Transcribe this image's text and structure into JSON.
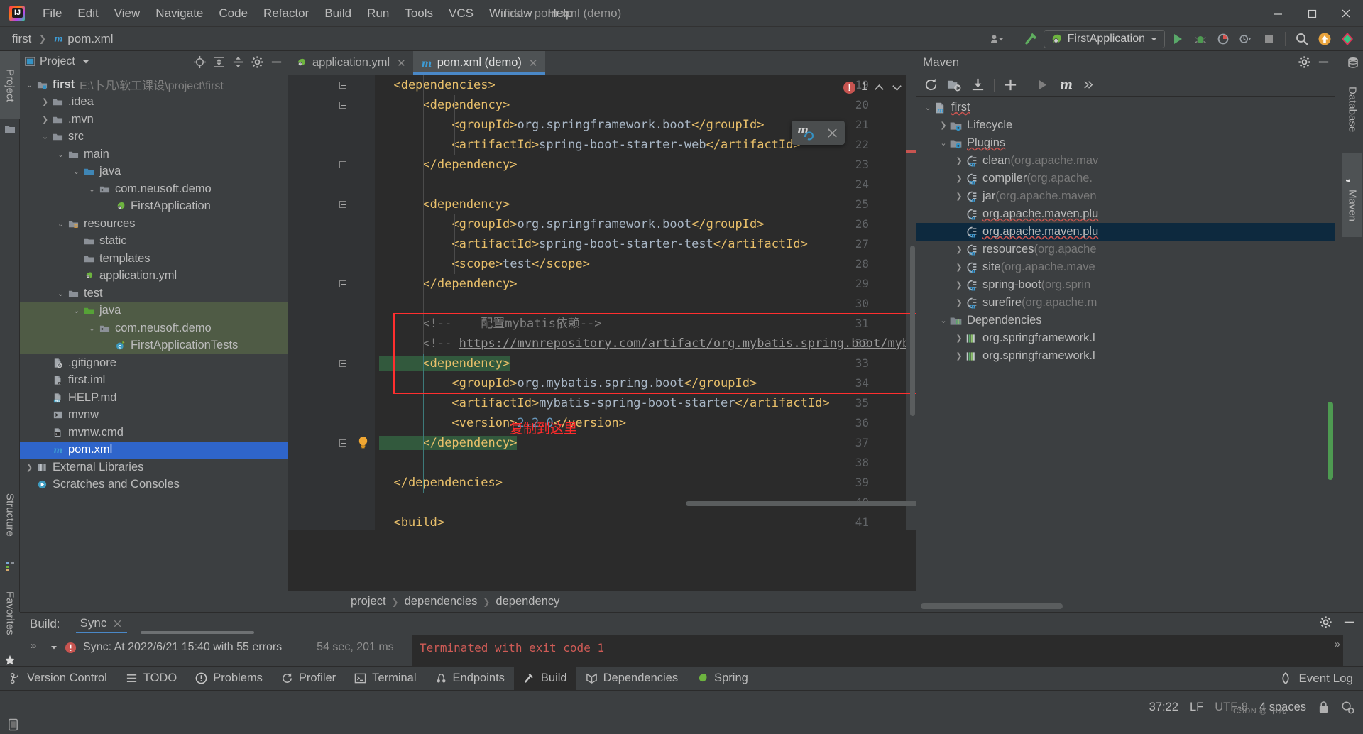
{
  "titlebar": {
    "window_title": "first - pom.xml (demo)",
    "menus": [
      "File",
      "Edit",
      "View",
      "Navigate",
      "Code",
      "Refactor",
      "Build",
      "Run",
      "Tools",
      "VCS",
      "Window",
      "Help"
    ],
    "minimize_icon": "minimize-icon",
    "maximize_icon": "maximize-icon",
    "close_icon": "close-icon"
  },
  "navbar": {
    "crumbs": [
      "first",
      "pom.xml"
    ],
    "run_config": "FirstApplication",
    "icons": [
      "user-dropdown-icon",
      "build-hammer-icon",
      "run-icon",
      "debug-icon",
      "run-coverage-icon",
      "profiler-icon",
      "stop-icon",
      "search-icon",
      "updates-icon",
      "ide-assistant-icon"
    ]
  },
  "left_stripe": {
    "project_label": "Project",
    "structure_label": "Structure",
    "favorites_label": "Favorites"
  },
  "project_panel": {
    "title": "Project",
    "actions": [
      "locate-icon",
      "expand-all-icon",
      "collapse-all-icon",
      "settings-icon",
      "hide-icon"
    ],
    "tree": [
      {
        "depth": 0,
        "arrow": "down",
        "icon": "module-folder-icon",
        "label": "first",
        "bold": true,
        "path": "E:\\卜凡\\软工课设\\project\\first"
      },
      {
        "depth": 1,
        "arrow": "right",
        "icon": "folder-icon",
        "label": ".idea"
      },
      {
        "depth": 1,
        "arrow": "right",
        "icon": "folder-icon",
        "label": ".mvn"
      },
      {
        "depth": 1,
        "arrow": "down",
        "icon": "folder-icon",
        "label": "src"
      },
      {
        "depth": 2,
        "arrow": "down",
        "icon": "folder-icon",
        "label": "main"
      },
      {
        "depth": 3,
        "arrow": "down",
        "icon": "source-folder-icon",
        "label": "java"
      },
      {
        "depth": 4,
        "arrow": "down",
        "icon": "package-icon",
        "label": "com.neusoft.demo"
      },
      {
        "depth": 5,
        "arrow": "none",
        "icon": "spring-class-icon",
        "label": "FirstApplication"
      },
      {
        "depth": 2,
        "arrow": "down",
        "icon": "resources-folder-icon",
        "label": "resources"
      },
      {
        "depth": 3,
        "arrow": "none",
        "icon": "folder-icon",
        "label": "static"
      },
      {
        "depth": 3,
        "arrow": "none",
        "icon": "folder-icon",
        "label": "templates"
      },
      {
        "depth": 3,
        "arrow": "none",
        "icon": "spring-yaml-icon",
        "label": "application.yml"
      },
      {
        "depth": 2,
        "arrow": "down",
        "icon": "folder-icon",
        "label": "test"
      },
      {
        "depth": 3,
        "arrow": "down",
        "icon": "test-folder-icon",
        "label": "java",
        "test": true
      },
      {
        "depth": 4,
        "arrow": "down",
        "icon": "package-icon",
        "label": "com.neusoft.demo",
        "test": true
      },
      {
        "depth": 5,
        "arrow": "none",
        "icon": "test-class-icon",
        "label": "FirstApplicationTests",
        "test": true
      },
      {
        "depth": 1,
        "arrow": "none",
        "icon": "gitignore-icon",
        "label": ".gitignore"
      },
      {
        "depth": 1,
        "arrow": "none",
        "icon": "iml-icon",
        "label": "first.iml"
      },
      {
        "depth": 1,
        "arrow": "none",
        "icon": "markdown-icon",
        "label": "HELP.md"
      },
      {
        "depth": 1,
        "arrow": "none",
        "icon": "shell-icon",
        "label": "mvnw"
      },
      {
        "depth": 1,
        "arrow": "none",
        "icon": "cmd-icon",
        "label": "mvnw.cmd"
      },
      {
        "depth": 1,
        "arrow": "none",
        "icon": "maven-file-icon",
        "label": "pom.xml",
        "selected": true
      },
      {
        "depth": 0,
        "arrow": "right",
        "icon": "libraries-icon",
        "label": "External Libraries"
      },
      {
        "depth": 0,
        "arrow": "none",
        "icon": "scratches-icon",
        "label": "Scratches and Consoles"
      }
    ]
  },
  "editor": {
    "tabs": [
      {
        "label": "application.yml",
        "icon": "spring-yaml-icon",
        "active": false
      },
      {
        "label": "pom.xml (demo)",
        "icon": "maven-file-icon",
        "active": true
      }
    ],
    "first_line_number": 19,
    "lines": [
      {
        "n": 19,
        "fold": "open",
        "segs": [
          {
            "t": "  <dependencies>",
            "c": "tagname"
          }
        ]
      },
      {
        "n": 20,
        "fold": "open",
        "segs": [
          {
            "t": "      <dependency>",
            "c": "tagname"
          }
        ]
      },
      {
        "n": 21,
        "fold": "none",
        "segs": [
          {
            "t": "          <groupId>",
            "c": "tagname"
          },
          {
            "t": "org.springframework.boot",
            "c": "plain"
          },
          {
            "t": "</groupId>",
            "c": "tagname"
          }
        ]
      },
      {
        "n": 22,
        "fold": "none",
        "segs": [
          {
            "t": "          <artifactId>",
            "c": "tagname"
          },
          {
            "t": "spring-boot-starter-web",
            "c": "plain"
          },
          {
            "t": "</artifactId>",
            "c": "tagname"
          }
        ]
      },
      {
        "n": 23,
        "fold": "close",
        "segs": [
          {
            "t": "      </dependency>",
            "c": "tagname"
          }
        ]
      },
      {
        "n": 24,
        "fold": "none",
        "segs": []
      },
      {
        "n": 25,
        "fold": "open",
        "segs": [
          {
            "t": "      <dependency>",
            "c": "tagname"
          }
        ]
      },
      {
        "n": 26,
        "fold": "none",
        "segs": [
          {
            "t": "          <groupId>",
            "c": "tagname"
          },
          {
            "t": "org.springframework.boot",
            "c": "plain"
          },
          {
            "t": "</groupId>",
            "c": "tagname"
          }
        ]
      },
      {
        "n": 27,
        "fold": "none",
        "segs": [
          {
            "t": "          <artifactId>",
            "c": "tagname"
          },
          {
            "t": "spring-boot-starter-test",
            "c": "plain"
          },
          {
            "t": "</artifactId>",
            "c": "tagname"
          }
        ]
      },
      {
        "n": 28,
        "fold": "none",
        "segs": [
          {
            "t": "          <scope>",
            "c": "tagname"
          },
          {
            "t": "test",
            "c": "plain"
          },
          {
            "t": "</scope>",
            "c": "tagname"
          }
        ]
      },
      {
        "n": 29,
        "fold": "close",
        "segs": [
          {
            "t": "      </dependency>",
            "c": "tagname"
          }
        ]
      },
      {
        "n": 30,
        "fold": "none",
        "segs": []
      },
      {
        "n": 31,
        "fold": "none",
        "segs": [
          {
            "t": "      <!--    配置mybatis依赖-->",
            "c": "comment"
          }
        ]
      },
      {
        "n": 32,
        "fold": "none",
        "segs": [
          {
            "t": "      <!-- ",
            "c": "comment"
          },
          {
            "t": "https://mvnrepository.com/artifact/org.mybatis.spring.boot/mybatis-sp",
            "c": "link-c"
          }
        ]
      },
      {
        "n": 33,
        "fold": "open",
        "segs": [
          {
            "t": "      <dependency>",
            "c": "tagname hl-sel"
          }
        ]
      },
      {
        "n": 34,
        "fold": "none",
        "segs": [
          {
            "t": "          <groupId>",
            "c": "tagname"
          },
          {
            "t": "org.mybatis.spring.boot",
            "c": "plain"
          },
          {
            "t": "</groupId>",
            "c": "tagname"
          }
        ]
      },
      {
        "n": 35,
        "fold": "none",
        "segs": [
          {
            "t": "          <artifactId>",
            "c": "tagname"
          },
          {
            "t": "mybatis-spring-boot-starter",
            "c": "plain"
          },
          {
            "t": "</artifactId>",
            "c": "tagname"
          }
        ]
      },
      {
        "n": 36,
        "fold": "none",
        "segs": [
          {
            "t": "          <version>",
            "c": "tagname"
          },
          {
            "t": "2.2.0",
            "c": "num"
          },
          {
            "t": "</version>",
            "c": "tagname"
          }
        ]
      },
      {
        "n": 37,
        "fold": "close",
        "segs": [
          {
            "t": "      </dependency>",
            "c": "tagname hl-sel"
          }
        ],
        "bulb": true
      },
      {
        "n": 38,
        "fold": "none",
        "segs": []
      },
      {
        "n": 39,
        "fold": "none",
        "segs": [
          {
            "t": "  </dependencies>",
            "c": "tagname"
          }
        ]
      },
      {
        "n": 40,
        "fold": "none",
        "segs": []
      },
      {
        "n": 41,
        "fold": "none",
        "segs": [
          {
            "t": "  <build>",
            "c": "tagname"
          }
        ]
      }
    ],
    "annotation_text": "复制到这里",
    "inspection": {
      "error_count": "1",
      "up_icon": "chevron-up-icon",
      "down_icon": "chevron-down-icon",
      "error_icon": "error-circle-icon"
    },
    "floating_popup": {
      "icon": "maven-reload-icon",
      "close": "close-icon"
    },
    "breadcrumbs": [
      "project",
      "dependencies",
      "dependency"
    ]
  },
  "maven_panel": {
    "title": "Maven",
    "head_actions": [
      "settings-icon",
      "hide-icon"
    ],
    "toolbar": [
      "reload-all-icon",
      "generate-sources-icon",
      "download-sources-icon",
      "add-icon",
      "run-icon",
      "maven-goal-icon",
      "more-icon"
    ],
    "tree": [
      {
        "depth": 0,
        "arrow": "down",
        "icon": "maven-project-icon",
        "label": "first",
        "squiggle": true
      },
      {
        "depth": 1,
        "arrow": "right",
        "icon": "phase-folder-icon",
        "label": "Lifecycle"
      },
      {
        "depth": 1,
        "arrow": "down",
        "icon": "phase-folder-icon",
        "label": "Plugins",
        "squiggle": true
      },
      {
        "depth": 2,
        "arrow": "right",
        "icon": "plugin-icon",
        "label": "clean",
        "dim": "(org.apache.mav"
      },
      {
        "depth": 2,
        "arrow": "right",
        "icon": "plugin-icon",
        "label": "compiler",
        "dim": "(org.apache."
      },
      {
        "depth": 2,
        "arrow": "right",
        "icon": "plugin-icon",
        "label": "jar",
        "dim": "(org.apache.maven"
      },
      {
        "depth": 2,
        "arrow": "none",
        "icon": "plugin-icon",
        "label": "org.apache.maven.plu",
        "squiggle": true
      },
      {
        "depth": 2,
        "arrow": "none",
        "icon": "plugin-icon",
        "label": "org.apache.maven.plu",
        "squiggle": true,
        "selected": true
      },
      {
        "depth": 2,
        "arrow": "right",
        "icon": "plugin-icon",
        "label": "resources",
        "dim": "(org.apache"
      },
      {
        "depth": 2,
        "arrow": "right",
        "icon": "plugin-icon",
        "label": "site",
        "dim": "(org.apache.mave"
      },
      {
        "depth": 2,
        "arrow": "right",
        "icon": "plugin-icon",
        "label": "spring-boot",
        "dim": "(org.sprin"
      },
      {
        "depth": 2,
        "arrow": "right",
        "icon": "plugin-icon",
        "label": "surefire",
        "dim": "(org.apache.m"
      },
      {
        "depth": 1,
        "arrow": "down",
        "icon": "dependencies-icon",
        "label": "Dependencies"
      },
      {
        "depth": 2,
        "arrow": "right",
        "icon": "dependency-icon",
        "label": "org.springframework.l"
      },
      {
        "depth": 2,
        "arrow": "right",
        "icon": "dependency-icon",
        "label": "org.springframework.l"
      }
    ]
  },
  "right_stripe": {
    "database_label": "Database",
    "maven_label": "Maven"
  },
  "build_panel": {
    "label": "Build:",
    "tab": "Sync",
    "sync_text": "Sync: At 2022/6/21 15:40 with 55 errors",
    "sync_time": "54 sec, 201 ms",
    "console_text": "Terminated with exit code 1",
    "actions": [
      "settings-icon",
      "hide-icon"
    ]
  },
  "bottom_bar": {
    "items": [
      {
        "label": "Version Control",
        "icon": "vcs-icon"
      },
      {
        "label": "TODO",
        "icon": "todo-icon"
      },
      {
        "label": "Problems",
        "icon": "problems-icon"
      },
      {
        "label": "Profiler",
        "icon": "profiler-icon"
      },
      {
        "label": "Terminal",
        "icon": "terminal-icon"
      },
      {
        "label": "Endpoints",
        "icon": "endpoints-icon"
      },
      {
        "label": "Build",
        "icon": "build-icon",
        "active": true
      },
      {
        "label": "Dependencies",
        "icon": "dependencies-icon"
      },
      {
        "label": "Spring",
        "icon": "spring-icon"
      }
    ],
    "event_log": "Event Log"
  },
  "status_bar": {
    "caret_position": "37:22",
    "line_separator": "LF",
    "encoding": "UTF-8",
    "indent": "4 spaces",
    "watermark": "CSDN @ 卜凡",
    "icons": [
      "lock-icon",
      "inspections-icon"
    ]
  }
}
